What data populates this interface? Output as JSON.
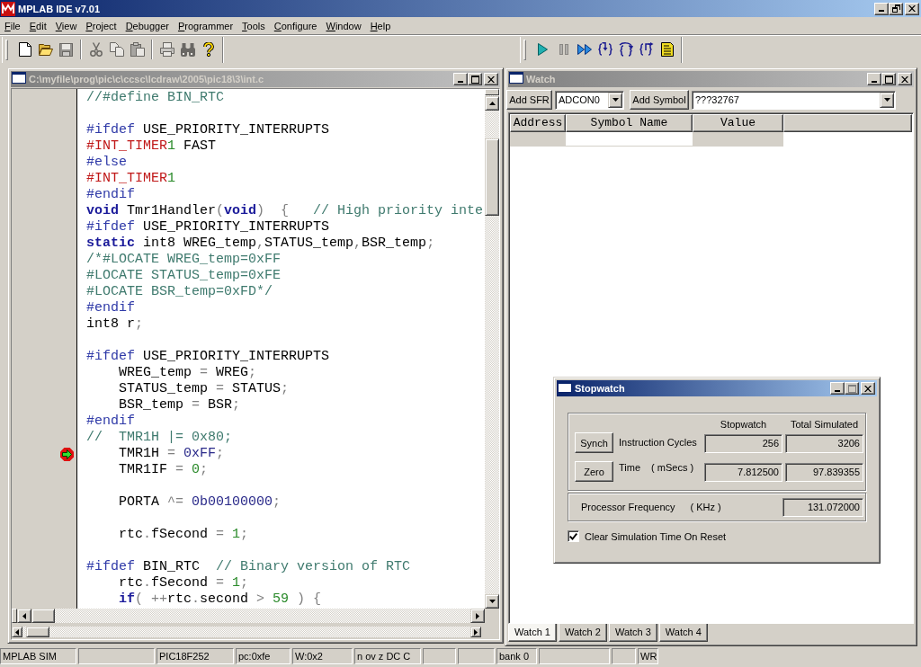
{
  "window": {
    "title": "MPLAB IDE v7.01",
    "active": true
  },
  "menu": [
    "File",
    "Edit",
    "View",
    "Project",
    "Debugger",
    "Programmer",
    "Tools",
    "Configure",
    "Window",
    "Help"
  ],
  "toolbars": [
    {
      "groups": [
        {
          "buttons": [
            {
              "kind": "new",
              "disabled": false
            },
            {
              "kind": "open",
              "disabled": false
            },
            {
              "kind": "save",
              "disabled": true
            }
          ]
        },
        {
          "buttons": [
            {
              "kind": "cut",
              "disabled": true
            },
            {
              "kind": "copy",
              "disabled": true
            },
            {
              "kind": "paste",
              "disabled": true
            }
          ]
        },
        {
          "buttons": [
            {
              "kind": "print",
              "disabled": true
            },
            {
              "kind": "find",
              "disabled": true
            },
            {
              "kind": "help",
              "disabled": false
            }
          ]
        }
      ]
    },
    {
      "groups": [
        {
          "buttons": [
            {
              "kind": "run",
              "disabled": false
            },
            {
              "kind": "halt",
              "disabled": true
            },
            {
              "kind": "animate",
              "disabled": false
            },
            {
              "kind": "stepinto",
              "disabled": false
            },
            {
              "kind": "stepover",
              "disabled": false
            },
            {
              "kind": "stepout",
              "disabled": false
            },
            {
              "kind": "reset",
              "disabled": false
            }
          ]
        }
      ]
    }
  ],
  "editor": {
    "title": "C:\\myfile\\prog\\pic\\c\\ccsc\\lcdraw\\2005\\pic18\\3\\int.c",
    "active": false,
    "lines": [
      {
        "breakpoint": false,
        "tokens": [
          {
            "kind": "comment",
            "text": "//#define BIN_RTC"
          }
        ]
      },
      {
        "breakpoint": false
      },
      {
        "breakpoint": false,
        "tokens": [
          {
            "kind": "directive",
            "text": "#ifdef"
          },
          {
            "kind": "plain",
            "text": " USE_PRIORITY_INTERRUPTS"
          }
        ]
      },
      {
        "breakpoint": false,
        "tokens": [
          {
            "kind": "pragma",
            "text": "#INT_TIMER"
          },
          {
            "kind": "number",
            "text": "1"
          },
          {
            "kind": "plain",
            "text": " FAST"
          }
        ]
      },
      {
        "breakpoint": false,
        "tokens": [
          {
            "kind": "directive",
            "text": "#else"
          }
        ]
      },
      {
        "breakpoint": false,
        "tokens": [
          {
            "kind": "pragma",
            "text": "#INT_TIMER"
          },
          {
            "kind": "number",
            "text": "1"
          }
        ]
      },
      {
        "breakpoint": false,
        "tokens": [
          {
            "kind": "directive",
            "text": "#endif"
          }
        ]
      },
      {
        "breakpoint": false,
        "tokens": [
          {
            "kind": "keyword",
            "text": "void"
          },
          {
            "kind": "plain",
            "text": " Tmr1Handler"
          },
          {
            "kind": "op",
            "text": "("
          },
          {
            "kind": "keyword",
            "text": "void"
          },
          {
            "kind": "op",
            "text": ")  {   "
          },
          {
            "kind": "comment",
            "text": "// High priority inte"
          }
        ]
      },
      {
        "breakpoint": false,
        "tokens": [
          {
            "kind": "directive",
            "text": "#ifdef"
          },
          {
            "kind": "plain",
            "text": " USE_PRIORITY_INTERRUPTS"
          }
        ]
      },
      {
        "breakpoint": false,
        "tokens": [
          {
            "kind": "keyword",
            "text": "static"
          },
          {
            "kind": "plain",
            "text": " int8 WREG_temp"
          },
          {
            "kind": "op",
            "text": ","
          },
          {
            "kind": "plain",
            "text": "STATUS_temp"
          },
          {
            "kind": "op",
            "text": ","
          },
          {
            "kind": "plain",
            "text": "BSR_temp"
          },
          {
            "kind": "op",
            "text": ";"
          }
        ]
      },
      {
        "breakpoint": false,
        "tokens": [
          {
            "kind": "comment",
            "text": "/*#LOCATE WREG_temp=0xFF"
          }
        ]
      },
      {
        "breakpoint": false,
        "tokens": [
          {
            "kind": "comment",
            "text": "#LOCATE STATUS_temp=0xFE"
          }
        ]
      },
      {
        "breakpoint": false,
        "tokens": [
          {
            "kind": "comment",
            "text": "#LOCATE BSR_temp=0xFD*/"
          }
        ]
      },
      {
        "breakpoint": false,
        "tokens": [
          {
            "kind": "directive",
            "text": "#endif"
          }
        ]
      },
      {
        "breakpoint": false,
        "tokens": [
          {
            "kind": "plain",
            "text": "int8 r"
          },
          {
            "kind": "op",
            "text": ";"
          }
        ]
      },
      {
        "breakpoint": false
      },
      {
        "breakpoint": false,
        "tokens": [
          {
            "kind": "directive",
            "text": "#ifdef"
          },
          {
            "kind": "plain",
            "text": " USE_PRIORITY_INTERRUPTS"
          }
        ]
      },
      {
        "breakpoint": false,
        "tokens": [
          {
            "kind": "plain",
            "text": "    WREG_temp "
          },
          {
            "kind": "op",
            "text": "= "
          },
          {
            "kind": "plain",
            "text": "WREG"
          },
          {
            "kind": "op",
            "text": ";"
          }
        ]
      },
      {
        "breakpoint": false,
        "tokens": [
          {
            "kind": "plain",
            "text": "    STATUS_temp "
          },
          {
            "kind": "op",
            "text": "= "
          },
          {
            "kind": "plain",
            "text": "STATUS"
          },
          {
            "kind": "op",
            "text": ";"
          }
        ]
      },
      {
        "breakpoint": false,
        "tokens": [
          {
            "kind": "plain",
            "text": "    BSR_temp "
          },
          {
            "kind": "op",
            "text": "= "
          },
          {
            "kind": "plain",
            "text": "BSR"
          },
          {
            "kind": "op",
            "text": ";"
          }
        ]
      },
      {
        "breakpoint": false,
        "tokens": [
          {
            "kind": "directive",
            "text": "#endif"
          }
        ]
      },
      {
        "breakpoint": false,
        "tokens": [
          {
            "kind": "comment",
            "text": "//  TMR1H |= 0x80;"
          }
        ]
      },
      {
        "breakpoint": true,
        "tokens": [
          {
            "kind": "plain",
            "text": "    TMR1H "
          },
          {
            "kind": "op",
            "text": "= "
          },
          {
            "kind": "hex",
            "text": "0xFF"
          },
          {
            "kind": "op",
            "text": ";"
          }
        ]
      },
      {
        "breakpoint": false,
        "tokens": [
          {
            "kind": "plain",
            "text": "    TMR1IF "
          },
          {
            "kind": "op",
            "text": "= "
          },
          {
            "kind": "number",
            "text": "0"
          },
          {
            "kind": "op",
            "text": ";"
          }
        ]
      },
      {
        "breakpoint": false
      },
      {
        "breakpoint": false,
        "tokens": [
          {
            "kind": "plain",
            "text": "    PORTA "
          },
          {
            "kind": "op",
            "text": "^= "
          },
          {
            "kind": "hex",
            "text": "0b00100000"
          },
          {
            "kind": "op",
            "text": ";"
          }
        ]
      },
      {
        "breakpoint": false
      },
      {
        "breakpoint": false,
        "tokens": [
          {
            "kind": "plain",
            "text": "    rtc"
          },
          {
            "kind": "op",
            "text": "."
          },
          {
            "kind": "plain",
            "text": "fSecond "
          },
          {
            "kind": "op",
            "text": "= "
          },
          {
            "kind": "number",
            "text": "1"
          },
          {
            "kind": "op",
            "text": ";"
          }
        ]
      },
      {
        "breakpoint": false
      },
      {
        "breakpoint": false,
        "tokens": [
          {
            "kind": "directive",
            "text": "#ifdef"
          },
          {
            "kind": "plain",
            "text": " BIN_RTC  "
          },
          {
            "kind": "comment",
            "text": "// Binary version of RTC"
          }
        ]
      },
      {
        "breakpoint": false,
        "tokens": [
          {
            "kind": "plain",
            "text": "    rtc"
          },
          {
            "kind": "op",
            "text": "."
          },
          {
            "kind": "plain",
            "text": "fSecond "
          },
          {
            "kind": "op",
            "text": "= "
          },
          {
            "kind": "number",
            "text": "1"
          },
          {
            "kind": "op",
            "text": ";"
          }
        ]
      },
      {
        "breakpoint": false,
        "tokens": [
          {
            "kind": "keyword",
            "text": "    if"
          },
          {
            "kind": "op",
            "text": "( ++"
          },
          {
            "kind": "plain",
            "text": "rtc"
          },
          {
            "kind": "op",
            "text": "."
          },
          {
            "kind": "plain",
            "text": "second "
          },
          {
            "kind": "op",
            "text": "> "
          },
          {
            "kind": "number",
            "text": "59"
          },
          {
            "kind": "op",
            "text": " ) {"
          }
        ]
      }
    ]
  },
  "watch": {
    "title": "Watch",
    "active": false,
    "add_sfr": "Add SFR",
    "sfr": "ADCON0",
    "add_symbol": "Add Symbol",
    "symbol": "???32767",
    "columns": [
      "Address",
      "Symbol Name",
      "Value"
    ],
    "tabs": [
      {
        "label": "Watch 1",
        "selected": true
      },
      {
        "label": "Watch 2",
        "selected": false
      },
      {
        "label": "Watch 3",
        "selected": false
      },
      {
        "label": "Watch 4",
        "selected": false
      }
    ]
  },
  "stopwatch": {
    "title": "Stopwatch",
    "active": true,
    "maximize_disabled": true,
    "columns": [
      "Stopwatch",
      "Total Simulated"
    ],
    "rows": [
      {
        "button": "Synch",
        "label": "Instruction Cycles",
        "values": [
          "256",
          "3206"
        ]
      },
      {
        "button": "Zero",
        "label": "Time",
        "unit": "( mSecs )",
        "values": [
          "7.812500",
          "97.839355"
        ]
      }
    ],
    "frequency": {
      "label": "Processor Frequency",
      "unit": "( KHz )",
      "value": "131.072000"
    },
    "clear_on_reset": {
      "label": "Clear Simulation Time On Reset",
      "checked": true
    }
  },
  "status_bar": [
    {
      "kind": "text",
      "text": "MPLAB SIM"
    },
    {
      "kind": "empty"
    },
    {
      "kind": "text",
      "text": "PIC18F252"
    },
    {
      "kind": "text",
      "text": "pc:0xfe"
    },
    {
      "kind": "text",
      "text": "W:0x2"
    },
    {
      "kind": "text",
      "text": "n ov z DC C"
    },
    {
      "kind": "empty"
    },
    {
      "kind": "empty"
    },
    {
      "kind": "text",
      "text": "bank 0"
    },
    {
      "kind": "empty"
    },
    {
      "kind": "empty"
    },
    {
      "kind": "text",
      "text": "WR"
    }
  ]
}
